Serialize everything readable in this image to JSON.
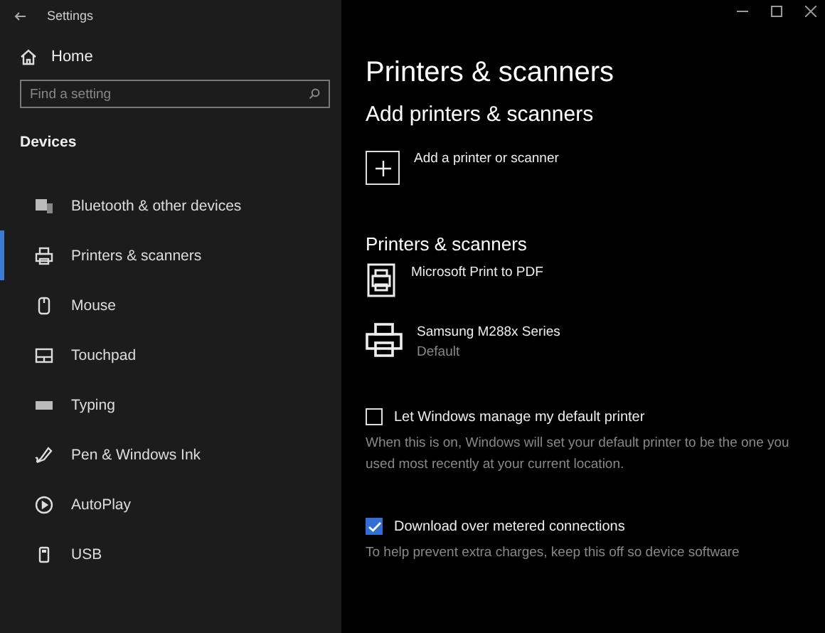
{
  "window": {
    "title": "Settings"
  },
  "sidebar": {
    "home": "Home",
    "search": {
      "placeholder": "Find a setting"
    },
    "section": "Devices",
    "items": [
      {
        "label": "Bluetooth & other devices",
        "kind": "bluetooth",
        "selected": false
      },
      {
        "label": "Printers & scanners",
        "kind": "printer",
        "selected": true
      },
      {
        "label": "Mouse",
        "kind": "mouse",
        "selected": false
      },
      {
        "label": "Touchpad",
        "kind": "touchpad",
        "selected": false
      },
      {
        "label": "Typing",
        "kind": "keyboard",
        "selected": false
      },
      {
        "label": "Pen & Windows Ink",
        "kind": "pen",
        "selected": false
      },
      {
        "label": "AutoPlay",
        "kind": "autoplay",
        "selected": false
      },
      {
        "label": "USB",
        "kind": "usb",
        "selected": false
      }
    ]
  },
  "content": {
    "title": "Printers & scanners",
    "add_heading": "Add printers & scanners",
    "add_button": "Add a printer or scanner",
    "list_heading": "Printers & scanners",
    "printers": [
      {
        "name": "Microsoft Print to PDF",
        "kind": "pdf"
      },
      {
        "name": "Samsung M288x Series",
        "status": "Default",
        "kind": "printer"
      }
    ],
    "options": [
      {
        "label": "Let Windows manage my default printer",
        "checked": false,
        "description": "When this is on, Windows will set your default printer to be the one you used most recently at your current location."
      },
      {
        "label": "Download over metered connections",
        "checked": true,
        "description": "To help prevent extra charges, keep this off so device software"
      }
    ]
  }
}
